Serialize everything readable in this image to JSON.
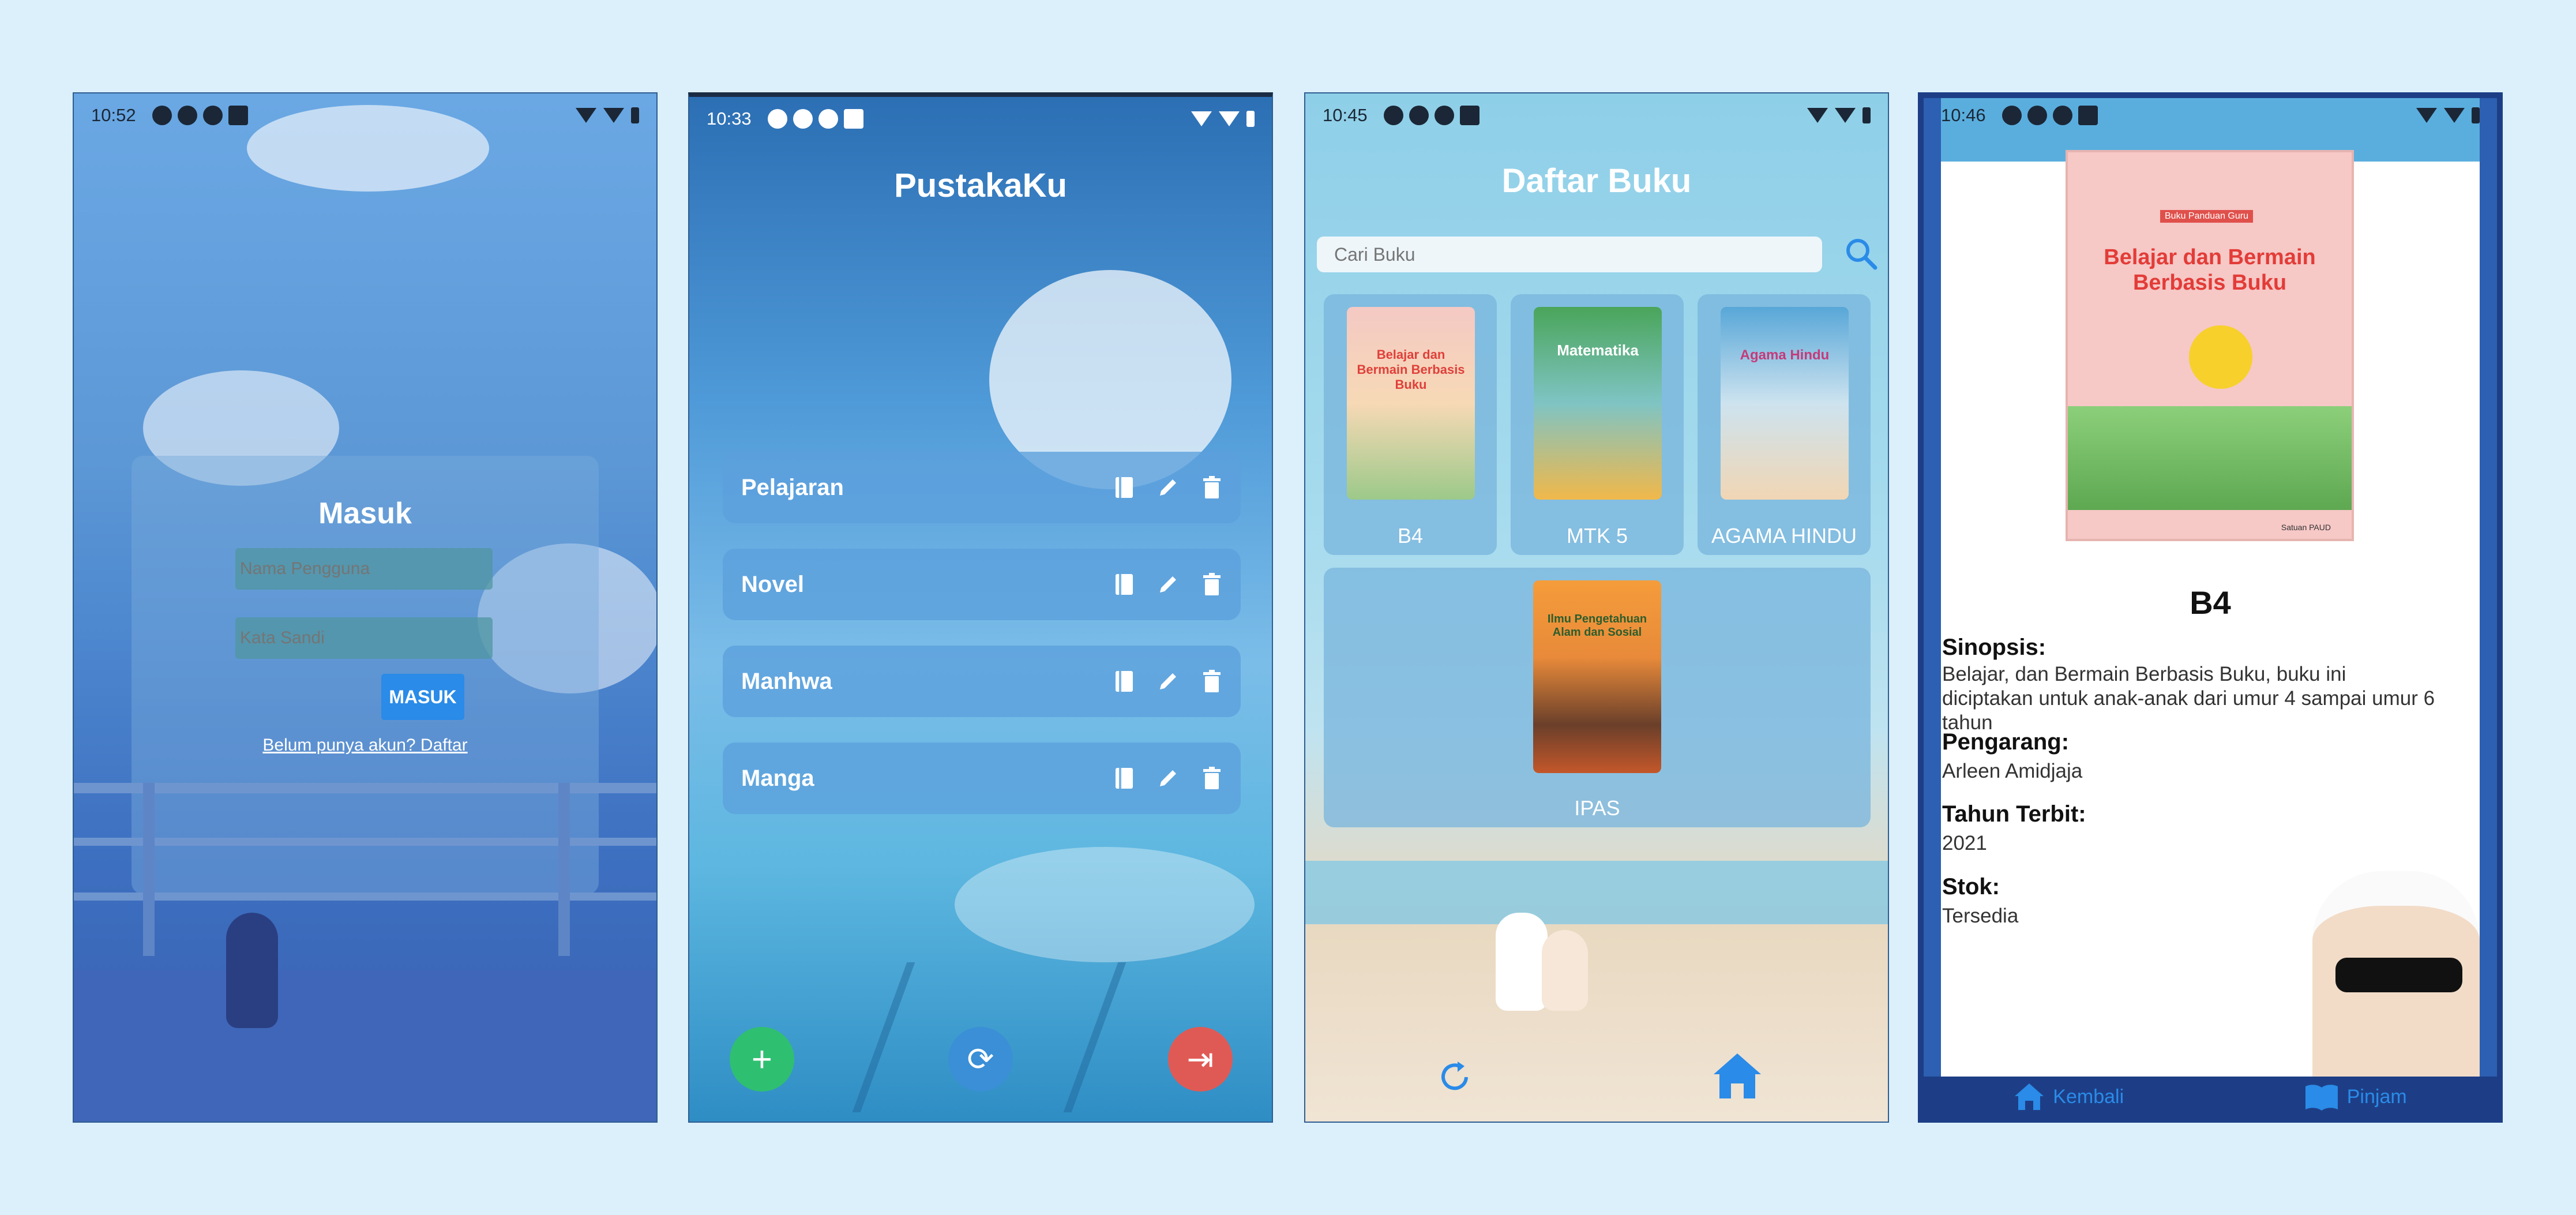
{
  "screens": {
    "login": {
      "time": "10:52",
      "title": "Masuk",
      "username_placeholder": "Nama Pengguna",
      "password_placeholder": "Kata Sandi",
      "button": "MASUK",
      "register_link": "Belum punya akun? Daftar"
    },
    "categories": {
      "time": "10:33",
      "title": "PustakaKu",
      "items": [
        {
          "label": "Pelajaran"
        },
        {
          "label": "Novel"
        },
        {
          "label": "Manhwa"
        },
        {
          "label": "Manga"
        }
      ],
      "fab_add": "+",
      "fab_refresh": "⟳",
      "fab_logout": "⇥"
    },
    "book_list": {
      "time": "10:45",
      "title": "Daftar Buku",
      "search_placeholder": "Cari Buku",
      "books": [
        {
          "label": "B4",
          "cover_title": "Belajar dan Bermain Berbasis Buku"
        },
        {
          "label": "MTK 5",
          "cover_title": "Matematika"
        },
        {
          "label": "AGAMA HINDU",
          "cover_title": "Agama Hindu"
        },
        {
          "label": "IPAS",
          "cover_title": "Ilmu Pengetahuan Alam dan Sosial"
        }
      ]
    },
    "detail": {
      "time": "10:46",
      "cover_title": "Belajar dan Bermain Berbasis Buku",
      "cover_tag": "Buku Panduan Guru",
      "cover_footer": "Satuan PAUD",
      "name": "B4",
      "synopsis_label": "Sinopsis:",
      "synopsis": "Belajar, dan Bermain Berbasis Buku, buku ini diciptakan untuk anak-anak dari umur 4 sampai umur 6 tahun",
      "author_label": "Pengarang:",
      "author": "Arleen Amidjaja",
      "year_label": "Tahun Terbit:",
      "year": "2021",
      "stock_label": "Stok:",
      "stock": "Tersedia",
      "nav_back": "Kembali",
      "nav_borrow": "Pinjam"
    }
  },
  "colors": {
    "primary_button": "#2a8be8",
    "fab_add": "#2fbf71",
    "fab_refresh": "#3a8fd6",
    "fab_logout": "#e05a55",
    "detail_border": "#1d3e86"
  }
}
